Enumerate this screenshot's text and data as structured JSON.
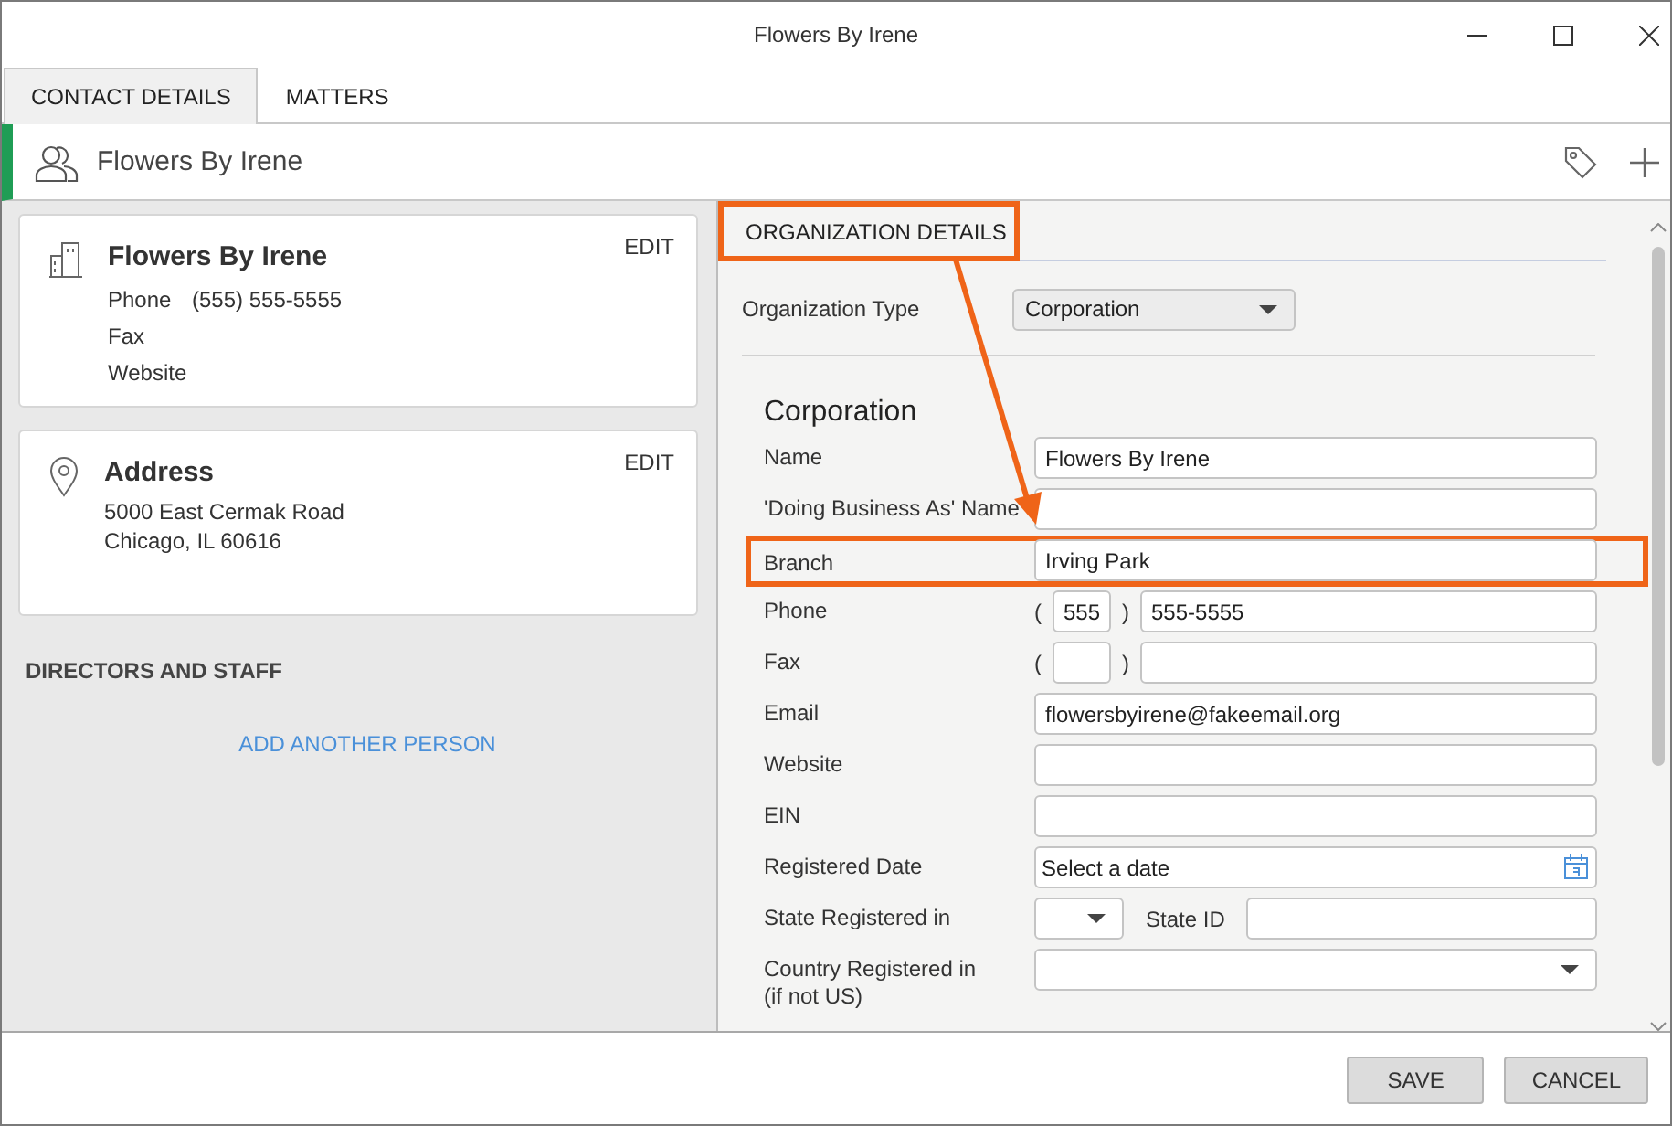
{
  "window": {
    "title": "Flowers By Irene"
  },
  "tabs": [
    {
      "label": "CONTACT DETAILS",
      "selected": true
    },
    {
      "label": "MATTERS",
      "selected": false
    }
  ],
  "header": {
    "title": "Flowers By Irene"
  },
  "cards": [
    {
      "kind": "contact",
      "title": "Flowers By Irene",
      "action": "EDIT",
      "fields": [
        {
          "label": "Phone",
          "value": "(555) 555-5555"
        },
        {
          "label": "Fax"
        },
        {
          "label": "Website"
        }
      ]
    },
    {
      "kind": "address",
      "title": "Address",
      "action": "EDIT",
      "lines": [
        "5000 East Cermak Road",
        "Chicago, IL 60616"
      ]
    }
  ],
  "staff": {
    "heading": "DIRECTORS AND STAFF",
    "link": "ADD ANOTHER PERSON"
  },
  "details": {
    "heading": "ORGANIZATION DETAILS",
    "highlighted": true,
    "type_label": "Organization Type",
    "type_value": "Corporation",
    "section_title": "Corporation",
    "rows": [
      {
        "kind": "text",
        "label": "Name",
        "value": "Flowers By Irene",
        "highlighted": false
      },
      {
        "kind": "text",
        "label": "'Doing Business As' Name",
        "highlighted": false
      },
      {
        "kind": "text",
        "label": "Branch",
        "value": "Irving Park",
        "highlighted": true
      },
      {
        "kind": "phone",
        "label": "Phone",
        "open": "(",
        "area": "555",
        "close": ")",
        "number": "555-5555",
        "highlighted": false
      },
      {
        "kind": "phone",
        "label": "Fax",
        "open": "(",
        "close": ")",
        "highlighted": false
      },
      {
        "kind": "text",
        "label": "Email",
        "value": "flowersbyirene@fakeemail.org",
        "highlighted": false
      },
      {
        "kind": "text",
        "label": "Website",
        "highlighted": false
      },
      {
        "kind": "text",
        "label": "EIN",
        "highlighted": false
      },
      {
        "kind": "date",
        "label": "Registered Date",
        "placeholder": "Select a date",
        "highlighted": false
      },
      {
        "kind": "state",
        "label": "State Registered in",
        "side_label": "State ID",
        "highlighted": false
      },
      {
        "kind": "select",
        "label": "Country Registered in (if not US)",
        "highlighted": false
      }
    ]
  },
  "buttons": [
    {
      "label": "SAVE"
    },
    {
      "label": "CANCEL"
    }
  ]
}
